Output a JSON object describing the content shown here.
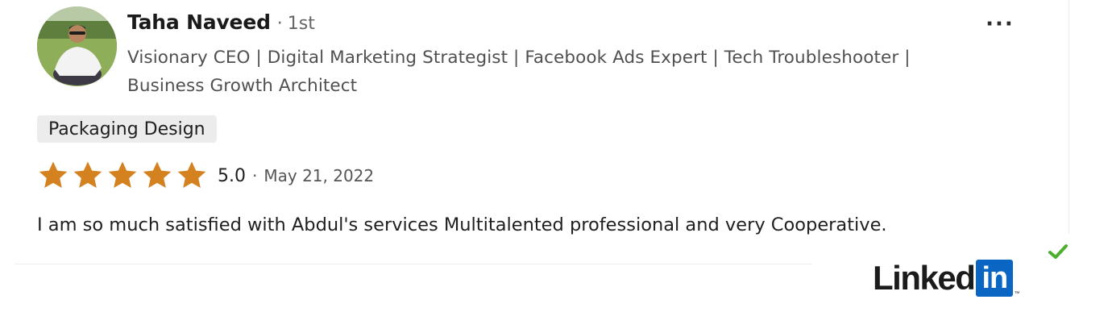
{
  "reviewer": {
    "name": "Taha Naveed",
    "separator": "·",
    "connection_degree": "1st",
    "headline": "Visionary CEO | Digital Marketing Strategist | Facebook Ads Expert | Tech Troubleshooter | Business Growth Architect"
  },
  "menu": {
    "more_label": "···"
  },
  "service_tag": "Packaging Design",
  "rating": {
    "value": "5.0",
    "separator": "·",
    "date": "May 21, 2022",
    "stars_filled": 5,
    "stars_total": 5,
    "star_color": "#d4811f"
  },
  "review_text": "I am so much satisfied with Abdul's services Multitalented professional and very Cooperative.",
  "branding": {
    "logo_word": "Linked",
    "logo_box": "in",
    "logo_mark": "™",
    "logo_color": "#0a66c2",
    "check_color": "#4caf2e"
  },
  "icons": [
    "avatar-photo",
    "more-options-icon",
    "star-icon",
    "checkmark-icon",
    "linkedin-logo"
  ]
}
